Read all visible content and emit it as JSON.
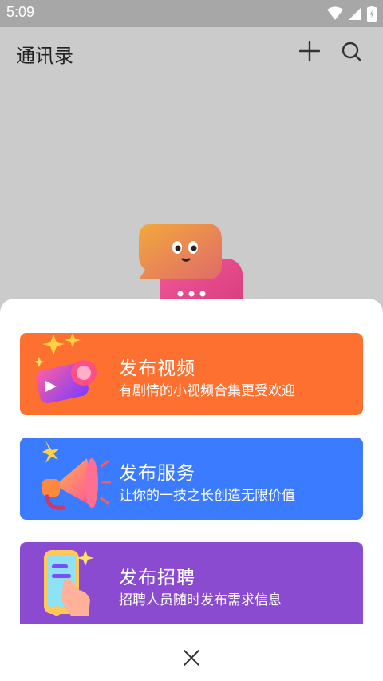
{
  "status_bar": {
    "time": "5:09",
    "icons": [
      "wifi-icon",
      "signal-icon",
      "battery-charging-icon"
    ]
  },
  "header": {
    "title": "通讯录",
    "actions": [
      "plus-icon",
      "search-icon"
    ]
  },
  "sheet": {
    "cards": [
      {
        "title": "发布视频",
        "subtitle": "有剧情的小视频合集更受欢迎",
        "color": "#fe7030",
        "icon": "camera-star-icon"
      },
      {
        "title": "发布服务",
        "subtitle": "让你的一技之长创造无限价值",
        "color": "#3a7bff",
        "icon": "megaphone-icon"
      },
      {
        "title": "发布招聘",
        "subtitle": "招聘人员随时发布需求信息",
        "color": "#8a4bd1",
        "icon": "phone-hand-icon"
      }
    ],
    "close_icon": "close-icon"
  }
}
